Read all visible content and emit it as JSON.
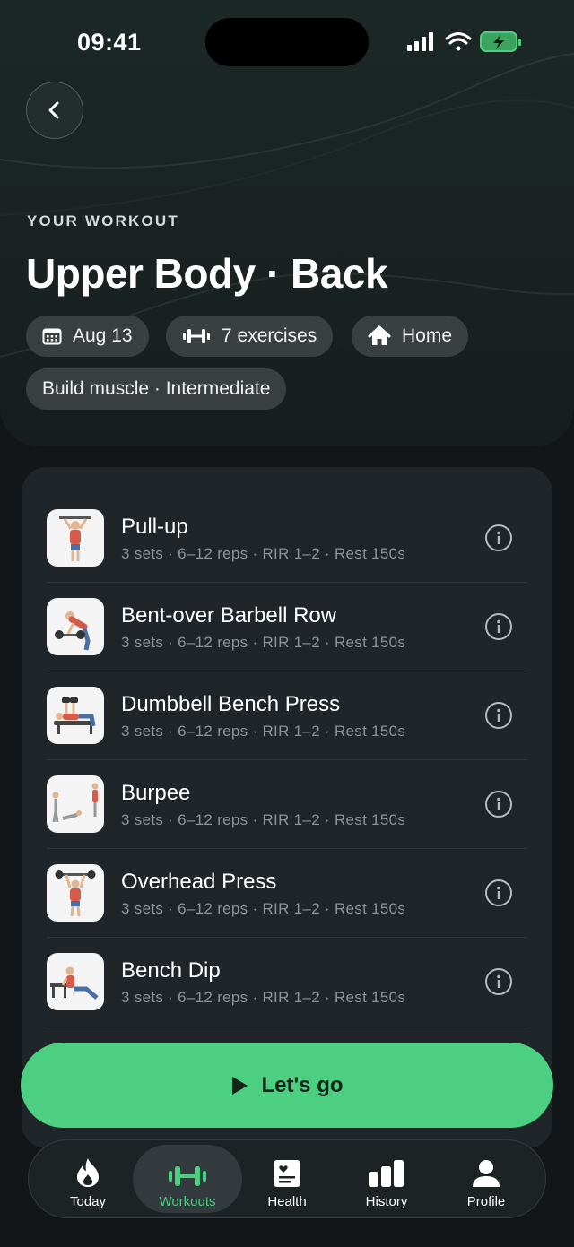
{
  "status_bar": {
    "time": "09:41"
  },
  "header": {
    "eyebrow": "YOUR WORKOUT",
    "title": "Upper Body · Back",
    "chips": {
      "date": "Aug 13",
      "exercises": "7 exercises",
      "location": "Home",
      "goal": "Build muscle · Intermediate"
    }
  },
  "exercises": [
    {
      "name": "Pull-up",
      "meta": "3 sets · 6–12 reps · RIR 1–2 · Rest 150s"
    },
    {
      "name": "Bent-over Barbell Row",
      "meta": "3 sets · 6–12 reps · RIR 1–2 · Rest 150s"
    },
    {
      "name": "Dumbbell Bench Press",
      "meta": "3 sets · 6–12 reps · RIR 1–2 · Rest 150s"
    },
    {
      "name": "Burpee",
      "meta": "3 sets · 6–12 reps · RIR 1–2 · Rest 150s"
    },
    {
      "name": "Overhead Press",
      "meta": "3 sets · 6–12 reps · RIR 1–2 · Rest 150s"
    },
    {
      "name": "Bench Dip",
      "meta": "3 sets · 6–12 reps · RIR 1–2 · Rest 150s"
    }
  ],
  "cta": {
    "label": "Let's go"
  },
  "tabbar": {
    "tabs": [
      {
        "label": "Today",
        "icon": "flame-icon"
      },
      {
        "label": "Workouts",
        "icon": "dumbbell-icon",
        "active": true
      },
      {
        "label": "Health",
        "icon": "health-icon"
      },
      {
        "label": "History",
        "icon": "bar-chart-icon"
      },
      {
        "label": "Profile",
        "icon": "person-icon"
      }
    ]
  },
  "colors": {
    "accent": "#4ccf81",
    "background": "#121619",
    "card": "#1f2528",
    "chip": "#3a4040"
  }
}
